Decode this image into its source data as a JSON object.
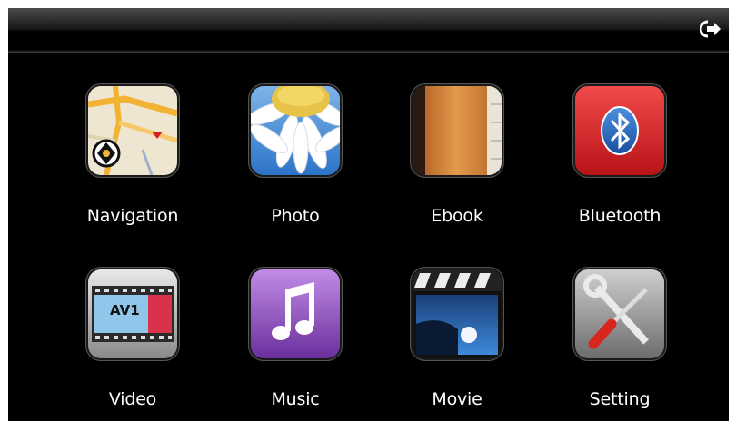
{
  "apps": [
    {
      "label": "Navigation",
      "icon": "map-navigation-icon"
    },
    {
      "label": "Photo",
      "icon": "daisy-photo-icon"
    },
    {
      "label": "Ebook",
      "icon": "book-icon"
    },
    {
      "label": "Bluetooth",
      "icon": "bluetooth-icon"
    },
    {
      "label": "Video",
      "icon": "film-strip-icon"
    },
    {
      "label": "Music",
      "icon": "music-note-icon"
    },
    {
      "label": "Movie",
      "icon": "clapperboard-icon"
    },
    {
      "label": "Setting",
      "icon": "wrench-screwdriver-icon"
    }
  ],
  "video_icon_text": "AV1",
  "colors": {
    "background": "#000000",
    "label": "#ffffff",
    "bluetooth": "#d8232a",
    "music": "#8d46b8",
    "ebook": "#d78a3c"
  }
}
